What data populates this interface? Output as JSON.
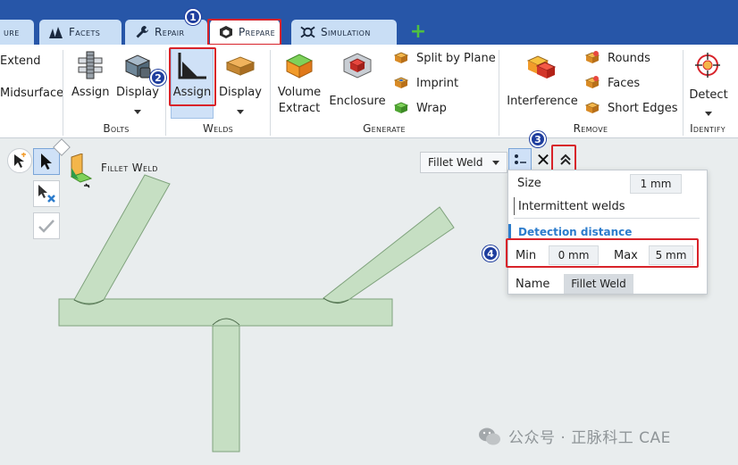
{
  "tabs": [
    {
      "label": "ure",
      "icon": "surface-icon"
    },
    {
      "label": "Facets",
      "icon": "facets-icon"
    },
    {
      "label": "Repair",
      "icon": "wrench-icon"
    },
    {
      "label": "Prepare",
      "icon": "prepare-cube-icon",
      "active": true
    },
    {
      "label": "Simulation",
      "icon": "simulation-icon"
    }
  ],
  "tab_add": "+",
  "ribbon": {
    "left_items": [
      "Extend",
      "Midsurface"
    ],
    "bolts": {
      "label": "Bolts",
      "assign": "Assign",
      "display": "Display"
    },
    "welds": {
      "label": "Welds",
      "assign": "Assign",
      "display": "Display"
    },
    "generate": {
      "label": "Generate",
      "volume_extract": [
        "Volume",
        "Extract"
      ],
      "enclosure": "Enclosure",
      "split_by_plane": "Split by Plane",
      "imprint": "Imprint",
      "wrap": "Wrap"
    },
    "remove": {
      "label": "Remove",
      "interference": "Interference",
      "rounds": "Rounds",
      "faces": "Faces",
      "short_edges": "Short Edges"
    },
    "identify": {
      "label": "Identify",
      "detect": "Detect"
    }
  },
  "badges": [
    "1",
    "2",
    "3",
    "4"
  ],
  "tool_title": "Fillet Weld",
  "options": {
    "dropdown_value": "Fillet Weld",
    "size_label": "Size",
    "size_value": "1 mm",
    "intermittent_label": "Intermittent welds",
    "detection_title": "Detection distance",
    "min_label": "Min",
    "min_value": "0 mm",
    "max_label": "Max",
    "max_value": "5 mm",
    "name_label": "Name",
    "name_value": "Fillet Weld"
  },
  "watermark": "公众号 · 正脉科工 CAE",
  "colors": {
    "tab_bar": "#2756a8",
    "highlight": "#d8232a",
    "badge": "#1f3e9e",
    "section": "#2c7ccc",
    "geometry": "#c6dfc3"
  }
}
